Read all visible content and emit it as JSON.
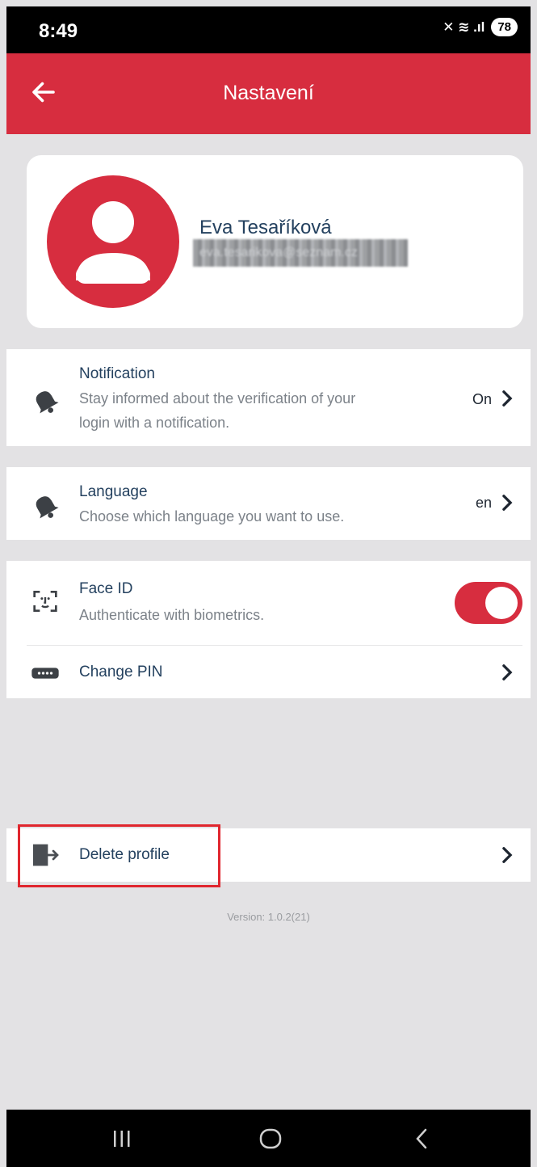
{
  "status_bar": {
    "time": "8:49",
    "signal_glyph": "✕ ≋ .ıl",
    "battery": "78"
  },
  "header": {
    "title": "Nastavení",
    "back_icon": "arrow-left-icon"
  },
  "profile": {
    "name": "Eva Tesaříková",
    "email": "eva.tesarikova@seznam.cz",
    "avatar_icon": "user-avatar-icon"
  },
  "settings": {
    "notification": {
      "title": "Notification",
      "desc_line1": "Stay informed about the verification of your",
      "desc_line2": "login with a notification.",
      "value": "On"
    },
    "language": {
      "title": "Language",
      "desc": "Choose which language you want to use.",
      "value": "en"
    },
    "face_id": {
      "title": "Face ID",
      "desc": "Authenticate with biometrics.",
      "enabled": true
    },
    "change_pin": {
      "title": "Change PIN"
    }
  },
  "delete_profile": {
    "title": "Delete profile"
  },
  "version": "Version: 1.0.2(21)",
  "colors": {
    "accent": "#d72d3f",
    "background": "#e3e2e4",
    "highlight": "#e0262e"
  }
}
